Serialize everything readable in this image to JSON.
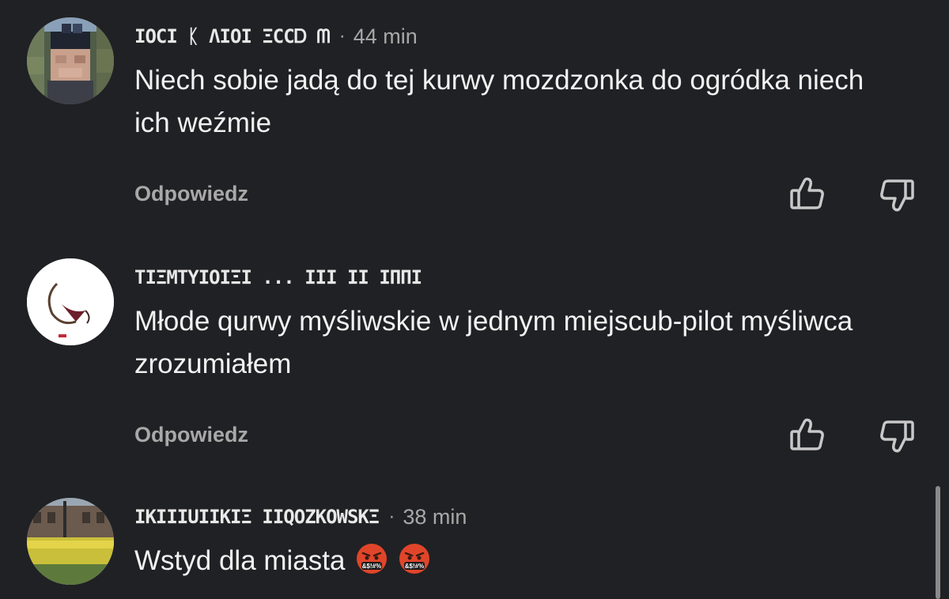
{
  "comments": [
    {
      "username": "ІΟϹΙ ᛕ ΛΙΟΙ ΞϹϹᎠ ᗰ",
      "separator": "·",
      "time": "44 min",
      "text": "Niech sobie jadą do tej kurwy mozdzonka do ogródka niech ich weźmie",
      "reply_label": "Odpowiedz"
    },
    {
      "username": "TIΞΜΤΥΙΟΙΞΙ ... ΙΙΙ   ΙΙ ΙΠΠΙ",
      "separator": "",
      "time": "",
      "text": "Młode qurwy myśliwskie w jednym miejscub-pilot myśliwca zrozumiałem",
      "reply_label": "Odpowiedz"
    },
    {
      "username": "ΙΚΙΙΙUΙΙΚΙΞ ΙΙQΟΖΚΟWSKΞ",
      "separator": "·",
      "time": "38 min",
      "text": "Wstyd dla miasta",
      "emoji": [
        "angry-cursing-face",
        "angry-cursing-face"
      ],
      "emoji_text": "&$!#%"
    }
  ],
  "colors": {
    "background": "#202124",
    "text": "#f2f2f2",
    "muted": "#a8a8a8",
    "emoji_red": "#e0452a"
  },
  "icons": [
    "thumbs-up-icon",
    "thumbs-down-icon"
  ]
}
